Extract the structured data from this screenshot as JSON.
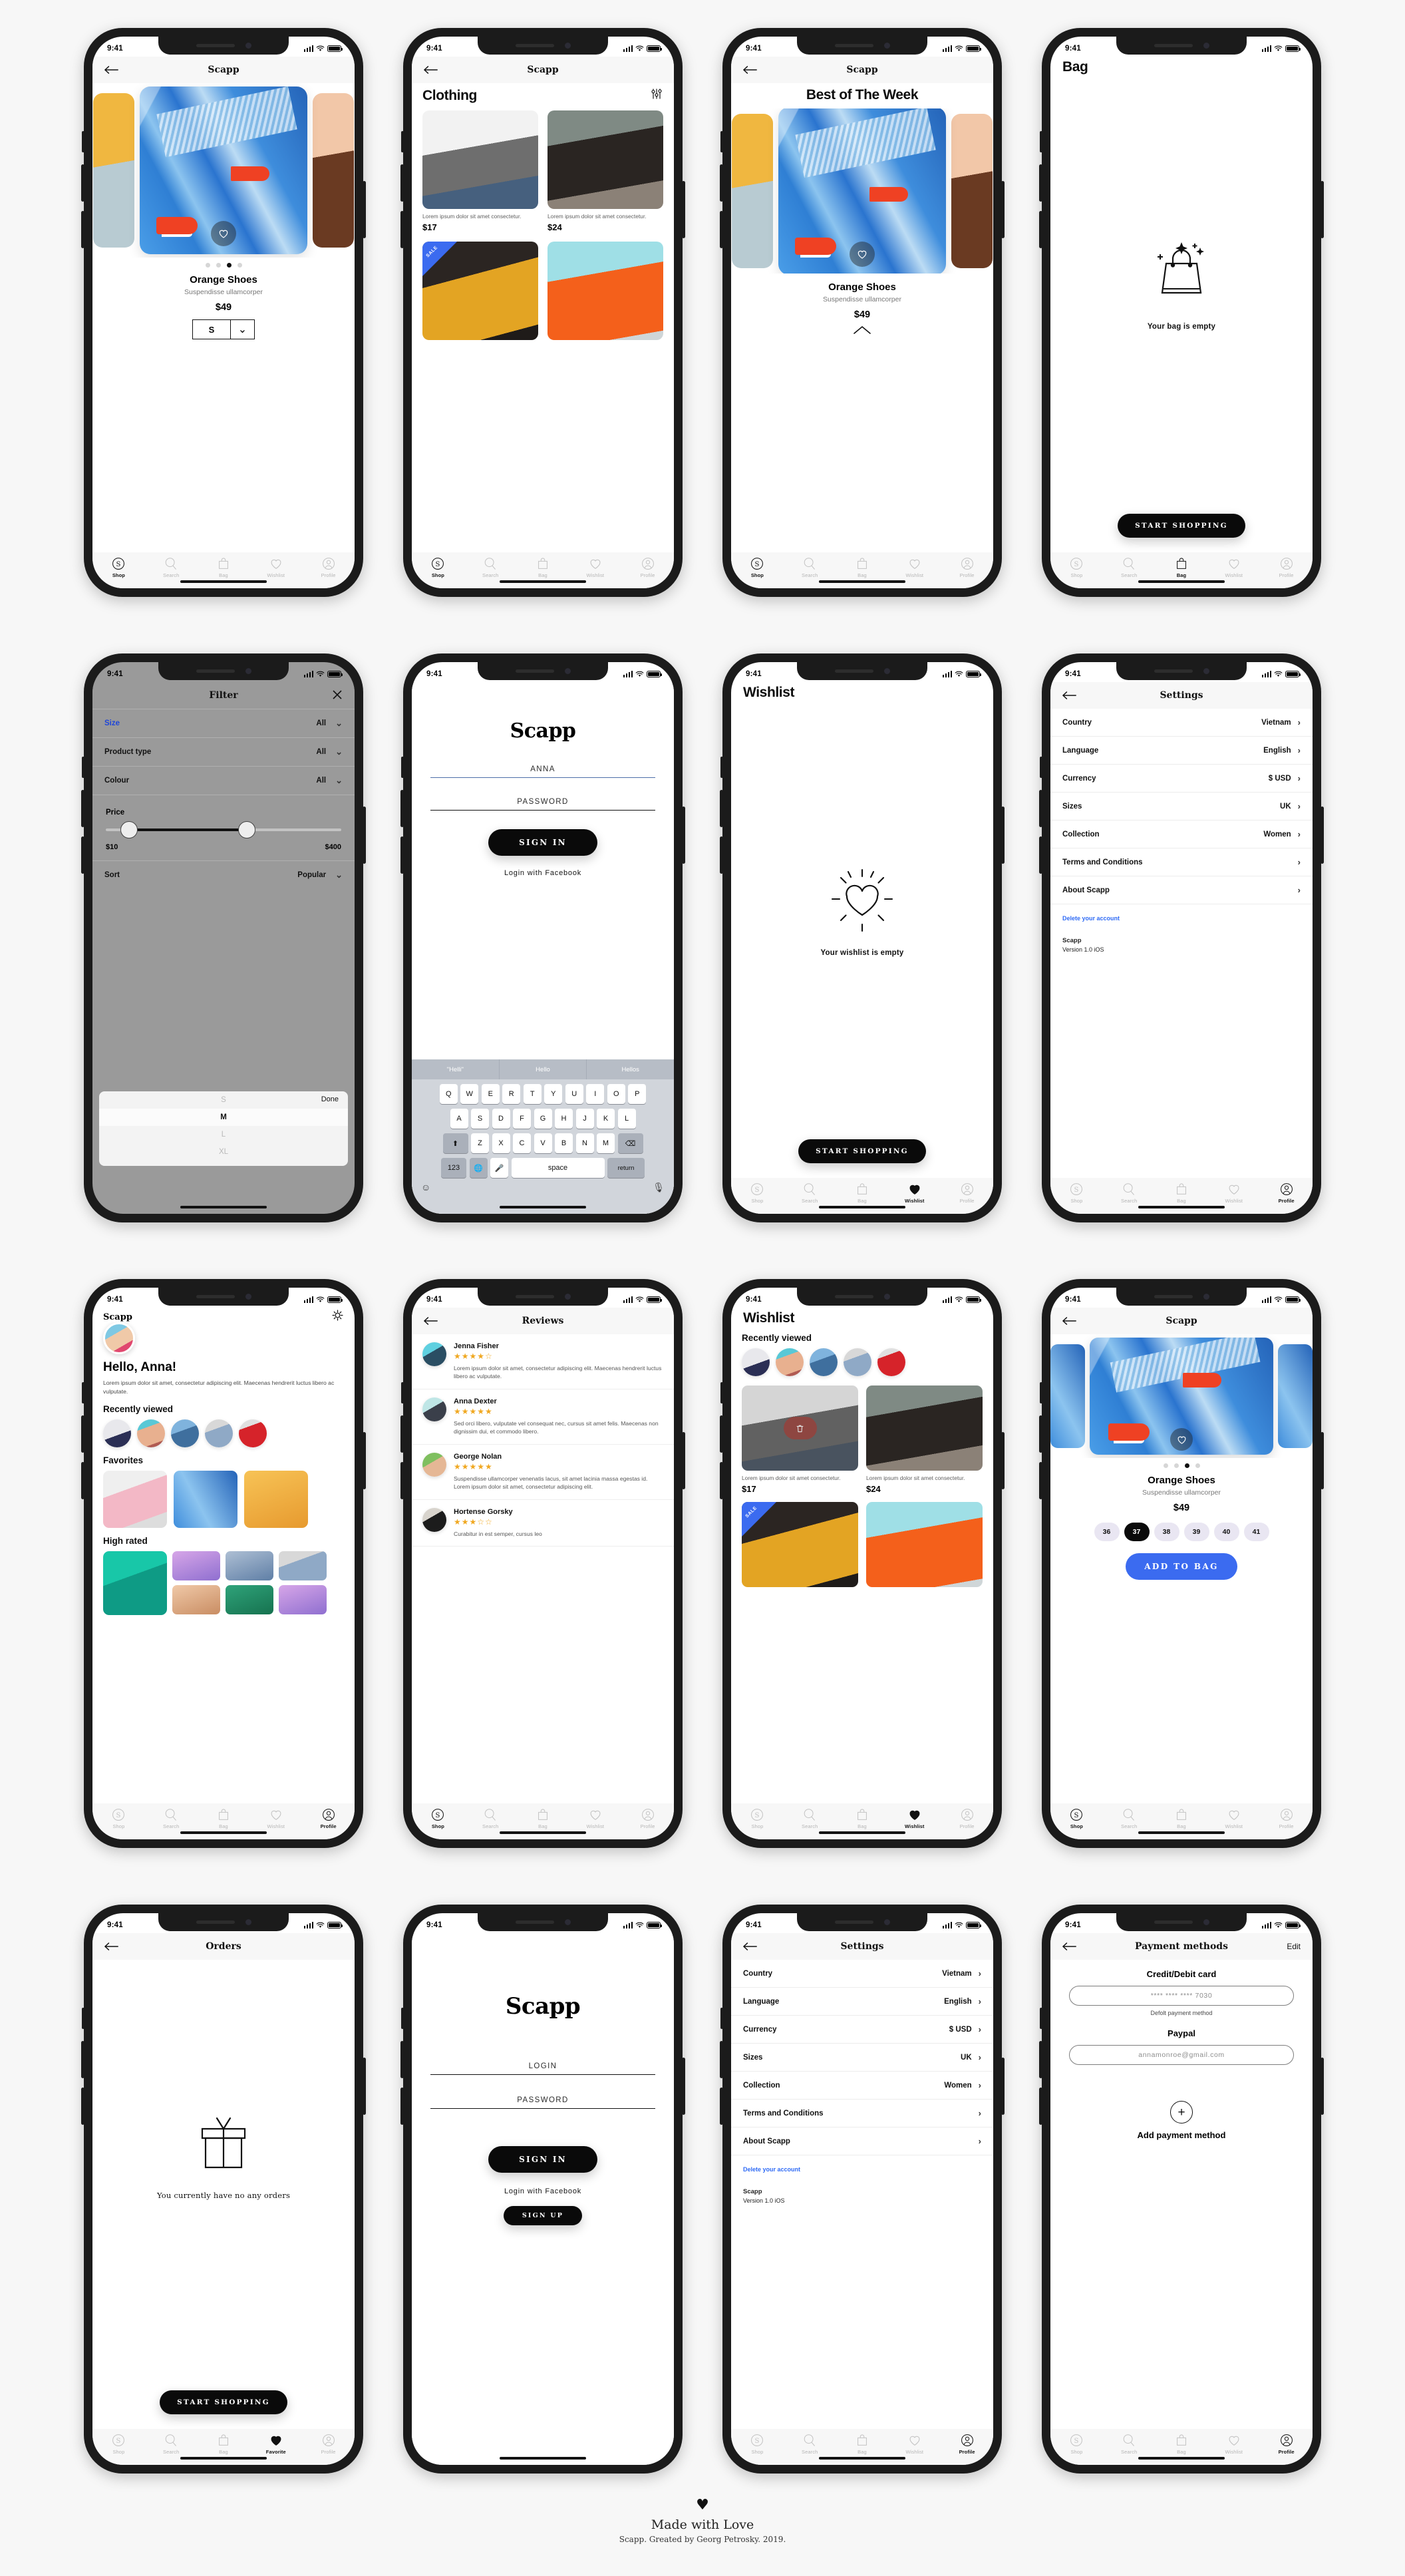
{
  "status_bar": {
    "time": "9:41"
  },
  "brand": "Scapp",
  "tabs": [
    {
      "label": "Shop",
      "icon": "shop-s-icon"
    },
    {
      "label": "Search",
      "icon": "search-icon"
    },
    {
      "label": "Bag",
      "icon": "bag-icon"
    },
    {
      "label": "Wishlist",
      "icon": "heart-icon"
    },
    {
      "label": "Profile",
      "icon": "profile-icon"
    }
  ],
  "tabs_alt_favorite": "Favorite",
  "screens": {
    "product": {
      "nav_title": "Scapp",
      "name": "Orange Shoes",
      "subtitle": "Suspendisse ullamcorper",
      "price": "$49",
      "size_value": "S",
      "active_dot": 2
    },
    "clothing": {
      "nav_title": "Scapp",
      "heading": "Clothing",
      "items": [
        {
          "desc": "Lorem ipsum dolor sit amet consectetur.",
          "price": "$17"
        },
        {
          "desc": "Lorem ipsum dolor sit amet consectetur.",
          "price": "$24"
        }
      ],
      "sale_label": "SALE"
    },
    "best_week": {
      "nav_title": "Scapp",
      "heading": "Best of The Week",
      "name": "Orange Shoes",
      "subtitle": "Suspendisse ullamcorper",
      "price": "$49"
    },
    "bag_empty": {
      "heading": "Bag",
      "empty_text": "Your bag is empty",
      "cta": "START SHOPPING"
    },
    "filter": {
      "nav_title": "Filter",
      "rows": [
        {
          "label": "Size",
          "value": "All",
          "accent": true
        },
        {
          "label": "Product type",
          "value": "All",
          "accent": false
        },
        {
          "label": "Colour",
          "value": "All",
          "accent": false
        }
      ],
      "price_label": "Price",
      "price_min": "$10",
      "price_max": "$400",
      "sort_label": "Sort",
      "sort_value": "Popular",
      "picker_done": "Done",
      "picker_options": [
        "S",
        "M",
        "L",
        "XL"
      ],
      "picker_selected": "M"
    },
    "signin_anna": {
      "logo": "Scapp",
      "login_value": "ANNA",
      "password_placeholder": "PASSWORD",
      "submit": "SIGN IN",
      "facebook": "Login with Facebook",
      "keyboard": {
        "suggestions": [
          "\"Helli\"",
          "Hello",
          "Hellos"
        ],
        "row1": [
          "Q",
          "W",
          "E",
          "R",
          "T",
          "Y",
          "U",
          "I",
          "O",
          "P"
        ],
        "row2": [
          "A",
          "S",
          "D",
          "F",
          "G",
          "H",
          "J",
          "K",
          "L"
        ],
        "row3": [
          "Z",
          "X",
          "C",
          "V",
          "B",
          "N",
          "M"
        ],
        "numeric": "123",
        "space": "space",
        "return": "return"
      }
    },
    "wishlist_empty": {
      "heading": "Wishlist",
      "empty_text": "Your wishlist is empty",
      "cta": "START SHOPPING"
    },
    "settings": {
      "nav_title": "Settings",
      "rows": [
        {
          "label": "Country",
          "value": "Vietnam"
        },
        {
          "label": "Language",
          "value": "English"
        },
        {
          "label": "Currency",
          "value": "$ USD"
        },
        {
          "label": "Sizes",
          "value": "UK"
        },
        {
          "label": "Collection",
          "value": "Women"
        },
        {
          "label": "Terms and Conditions",
          "value": ""
        },
        {
          "label": "About Scapp",
          "value": ""
        }
      ],
      "delete_link": "Delete your account",
      "app_name": "Scapp",
      "version": "Version 1.0 iOS"
    },
    "profile": {
      "brand": "Scapp",
      "greeting": "Hello, Anna!",
      "bio": "Lorem ipsum dolor sit amet, consectetur adipiscing elit. Maecenas hendrerit luctus libero ac vulputate.",
      "recently_viewed": "Recently viewed",
      "favorites": "Favorites",
      "high_rated": "High rated"
    },
    "reviews": {
      "nav_title": "Reviews",
      "items": [
        {
          "name": "Jenna Fisher",
          "rating": 4,
          "text": "Lorem ipsum dolor sit amet, consectetur adipiscing elit. Maecenas hendrerit luctus libero ac vulputate."
        },
        {
          "name": "Anna Dexter",
          "rating": 5,
          "text": "Sed orci libero, vulputate vel consequat nec, cursus sit amet felis. Maecenas non dignissim dui, et commodo libero."
        },
        {
          "name": "George Nolan",
          "rating": 5,
          "text": "Suspendisse ullamcorper venenatis lacus, sit amet lacinia massa egestas id. Lorem ipsum dolor sit amet, consectetur adipiscing elit."
        },
        {
          "name": "Hortense Gorsky",
          "rating": 3,
          "text": "Curabitur in est semper, cursus leo"
        }
      ]
    },
    "wishlist_full": {
      "heading": "Wishlist",
      "recently_viewed": "Recently viewed",
      "items": [
        {
          "desc": "Lorem ipsum dolor sit amet consectetur.",
          "price": "$17"
        },
        {
          "desc": "Lorem ipsum dolor sit amet consectetur.",
          "price": "$24"
        }
      ],
      "sale_label": "SALE"
    },
    "product_sizes": {
      "nav_title": "Scapp",
      "name": "Orange Shoes",
      "subtitle": "Suspendisse ullamcorper",
      "price": "$49",
      "sizes": [
        "36",
        "37",
        "38",
        "39",
        "40",
        "41"
      ],
      "selected_size": "37",
      "cta": "ADD TO BAG",
      "active_dot": 2
    },
    "orders_empty": {
      "nav_title": "Orders",
      "empty_text": "You currently have no any orders",
      "cta": "START SHOPPING"
    },
    "login": {
      "logo": "Scapp",
      "login_placeholder": "LOGIN",
      "password_placeholder": "PASSWORD",
      "submit": "SIGN IN",
      "facebook": "Login with Facebook",
      "signup": "SIGN UP"
    },
    "settings_2": {
      "nav_title": "Settings",
      "rows": [
        {
          "label": "Country",
          "value": "Vietnam"
        },
        {
          "label": "Language",
          "value": "English"
        },
        {
          "label": "Currency",
          "value": "$ USD"
        },
        {
          "label": "Sizes",
          "value": "UK"
        },
        {
          "label": "Collection",
          "value": "Women"
        },
        {
          "label": "Terms and Conditions",
          "value": ""
        },
        {
          "label": "About Scapp",
          "value": ""
        }
      ],
      "delete_link": "Delete your account",
      "app_name": "Scapp",
      "version": "Version 1.0 iOS"
    },
    "payment": {
      "nav_title": "Payment methods",
      "edit": "Edit",
      "card_heading": "Credit/Debit card",
      "card_number": "**** **** **** 7030",
      "card_sub": "Defolt payment method",
      "paypal_heading": "Paypal",
      "paypal_email": "annamonroe@gmail.com",
      "add_label": "Add payment method"
    }
  },
  "footer": {
    "heart": "♥",
    "line1": "Made with Love",
    "line2": "Scapp. Greated by Georg Petrosky. 2019."
  },
  "colors": {
    "accent_blue": "#3b6bf0",
    "link_blue": "#2f6bf5",
    "sale_blue": "#3b6bf0",
    "delete_red": "#f23a2f",
    "star_gold": "#f0a821",
    "black": "#0a0a0a"
  }
}
